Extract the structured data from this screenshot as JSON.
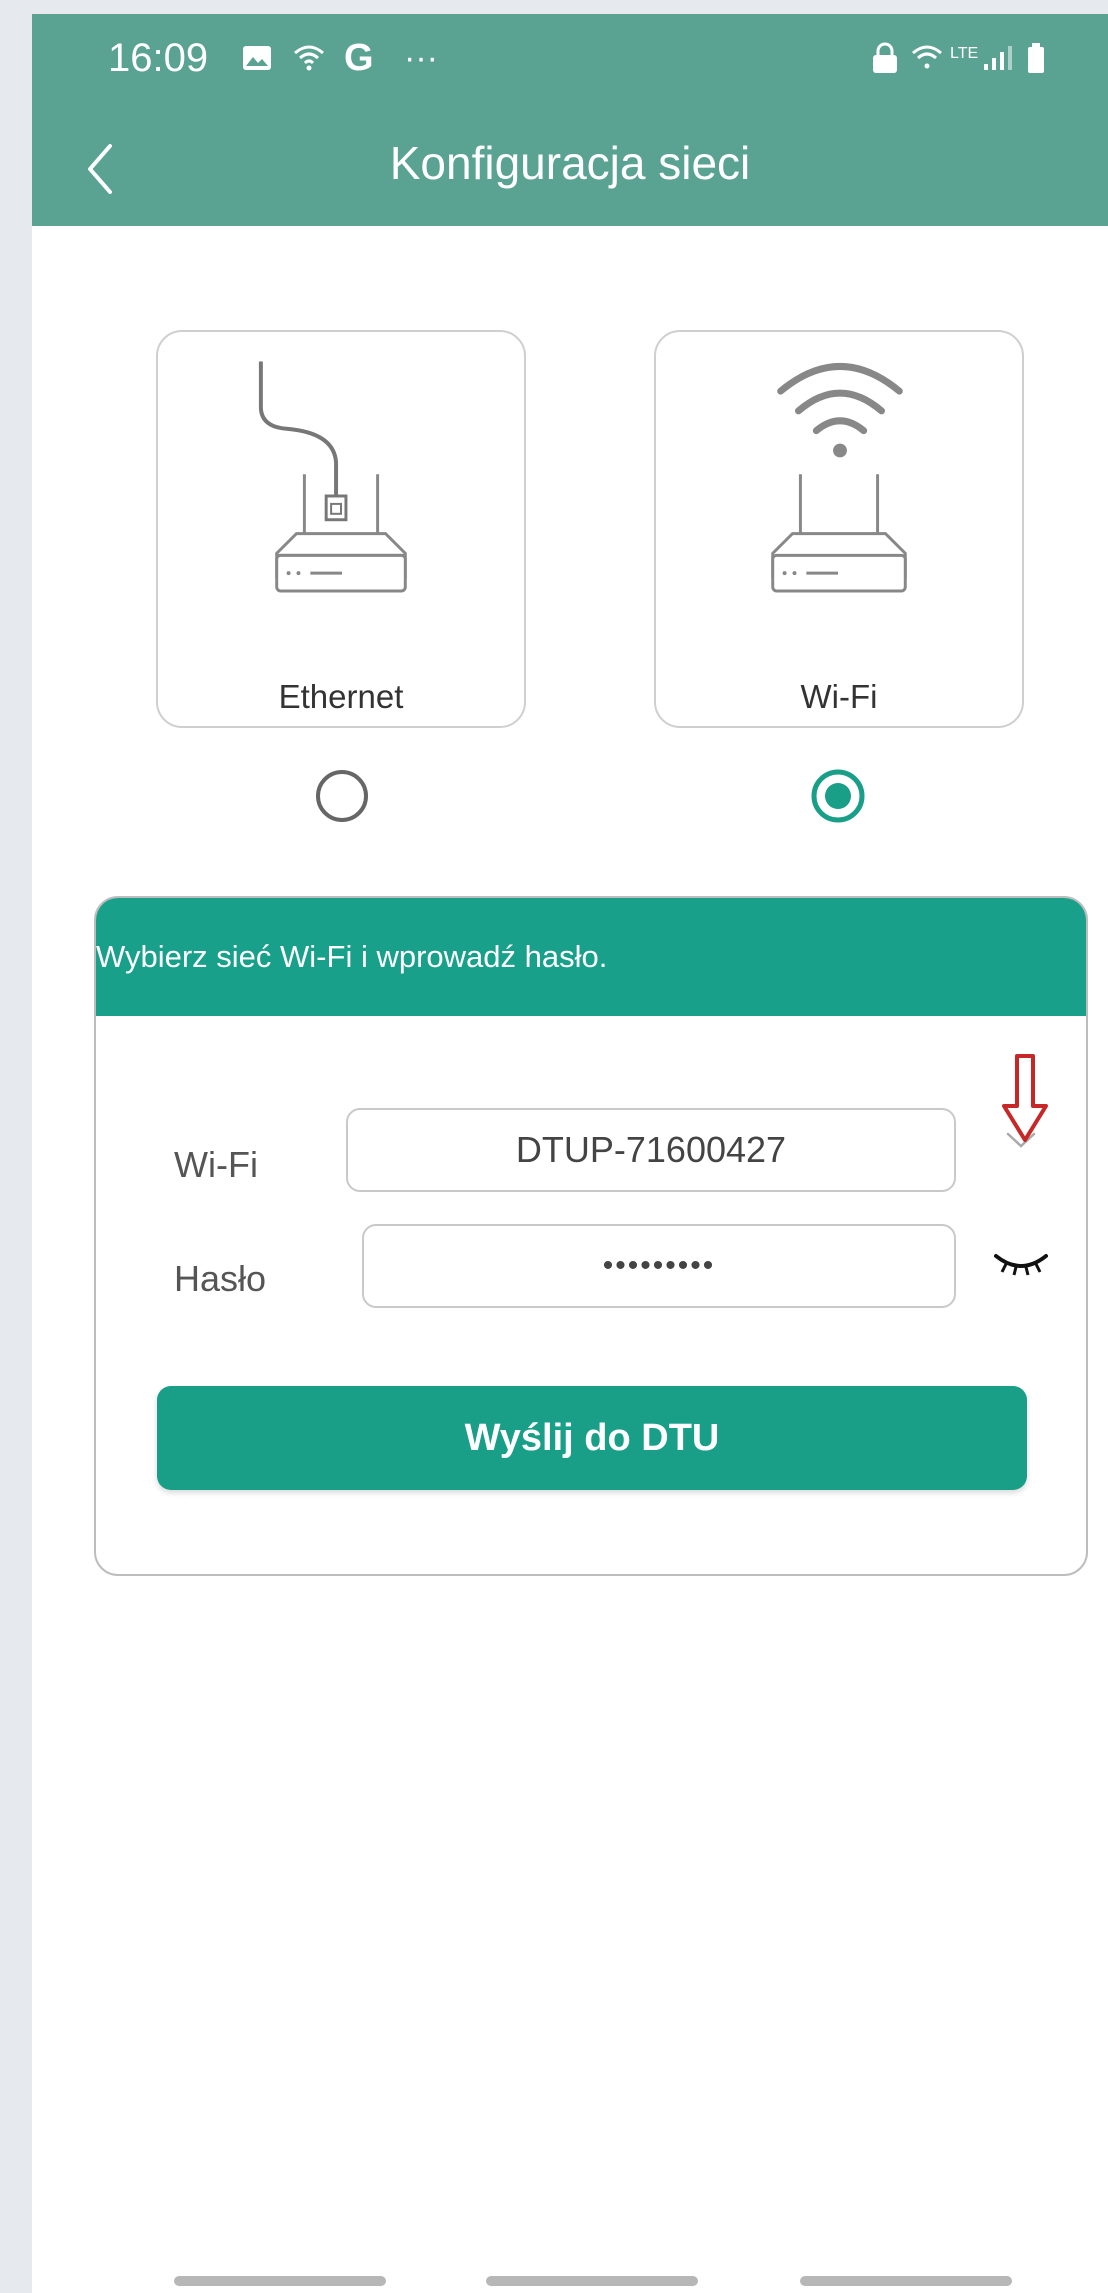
{
  "status_bar": {
    "time": "16:09",
    "left_icons": [
      "image-icon",
      "wifi-calling-icon",
      "google-g-icon",
      "more-dots-icon"
    ],
    "right_icons": [
      "lock-icon",
      "wifi-calling-icon",
      "lte-icon",
      "signal-icon",
      "battery-icon"
    ],
    "lte_text": "LTE",
    "google_letter": "G",
    "more_dots": "···"
  },
  "header": {
    "title": "Konfiguracja sieci",
    "back_icon": "chevron-left-icon"
  },
  "network_options": [
    {
      "label": "Ethernet",
      "icon": "router-ethernet-icon",
      "selected": false
    },
    {
      "label": "Wi-Fi",
      "icon": "router-wifi-icon",
      "selected": true
    }
  ],
  "wifi_panel": {
    "header_text": "Wybierz sieć Wi-Fi i wprowadź hasło.",
    "ssid_label": "Wi-Fi",
    "ssid_value": "DTUP-71600427",
    "password_label": "Hasło",
    "password_value": "•••••••••",
    "send_button": "Wyślij do DTU"
  },
  "colors": {
    "header_bg": "#5aa392",
    "accent": "#199e88",
    "annotation_arrow": "#c62828"
  }
}
